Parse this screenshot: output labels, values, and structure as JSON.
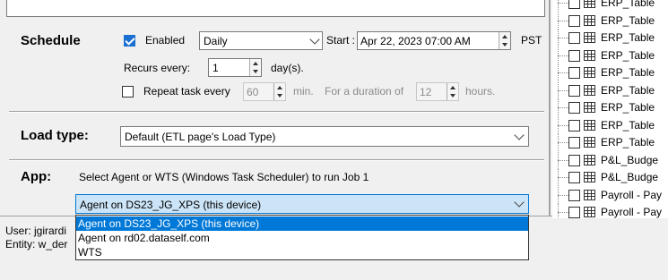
{
  "schedule": {
    "heading": "Schedule",
    "enabled_label": "Enabled",
    "enabled": true,
    "frequency": "Daily",
    "start_label": "Start :",
    "start_value": "Apr 22, 2023  07:00 AM",
    "timezone": "PST",
    "recurs_label": "Recurs every:",
    "recurs_value": "1",
    "recurs_unit": "day(s).",
    "repeat_label": "Repeat task every",
    "repeat_checked": false,
    "repeat_value": "60",
    "repeat_unit": "min.",
    "duration_label": "For a duration of",
    "duration_value": "12",
    "duration_unit": "hours."
  },
  "load_type": {
    "heading": "Load type:",
    "value": "Default (ETL page's Load Type)"
  },
  "app": {
    "heading": "App:",
    "description": "Select Agent or WTS (Windows Task Scheduler) to run Job 1",
    "selected": "Agent on DS23_JG_XPS (this device)",
    "options": [
      "Agent on DS23_JG_XPS (this device)",
      "Agent on rd02.dataself.com",
      "WTS"
    ]
  },
  "status": {
    "user_label": "User:  jgirardi",
    "entity_label": "Entity: w_der"
  },
  "tree": {
    "items": [
      "ERP_Table",
      "ERP_Table",
      "ERP_Table",
      "ERP_Table",
      "ERP_Table",
      "ERP_Table",
      "ERP_Table",
      "ERP_Table",
      "ERP_Table",
      "P&L_Budge",
      "P&L_Budge",
      "Payroll - Pay",
      "Payroll - Pay"
    ]
  }
}
